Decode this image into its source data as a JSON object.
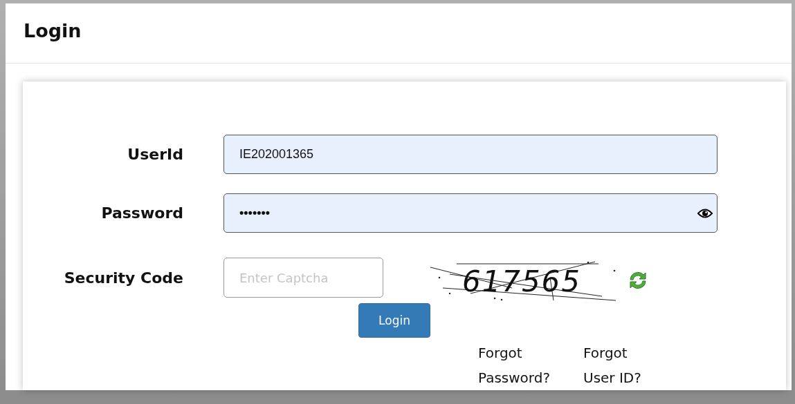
{
  "panel": {
    "title": "Login"
  },
  "form": {
    "userid": {
      "label": "UserId",
      "value": "IE202001365"
    },
    "password": {
      "label": "Password",
      "value": "•••••••"
    },
    "security": {
      "label": "Security Code",
      "placeholder": "Enter Captcha",
      "captcha": "617565"
    },
    "submit": "Login",
    "links": [
      "Forgot Password?",
      "Forgot User ID?"
    ]
  }
}
